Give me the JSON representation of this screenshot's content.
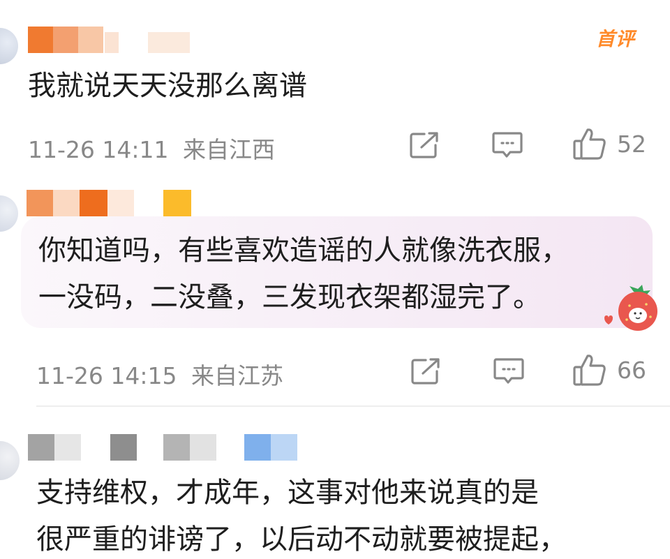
{
  "comments": [
    {
      "badge": "首评",
      "text": "我就说天天没那么离谱",
      "time": "11-26 14:11",
      "location": "来自江西",
      "likes": "52"
    },
    {
      "text_line1": "你知道吗，有些喜欢造谣的人就像洗衣服，",
      "text_line2": "一没码，二没叠，三发现衣架都湿完了。",
      "time": "11-26 14:15",
      "location": "来自江苏",
      "likes": "66"
    },
    {
      "text_line1": "支持维权，才成年，这事对他来说真的是",
      "text_line2": "很严重的诽谤了，以后动不动就要被提起，"
    }
  ],
  "icons": {
    "share": "share-icon",
    "reply": "reply-icon",
    "like": "thumbs-up-icon",
    "sticker": "strawberry-sticker-icon"
  },
  "colors": {
    "badge": "#ff8a2a",
    "meta": "#888888",
    "bubble": "#f7eef7"
  }
}
